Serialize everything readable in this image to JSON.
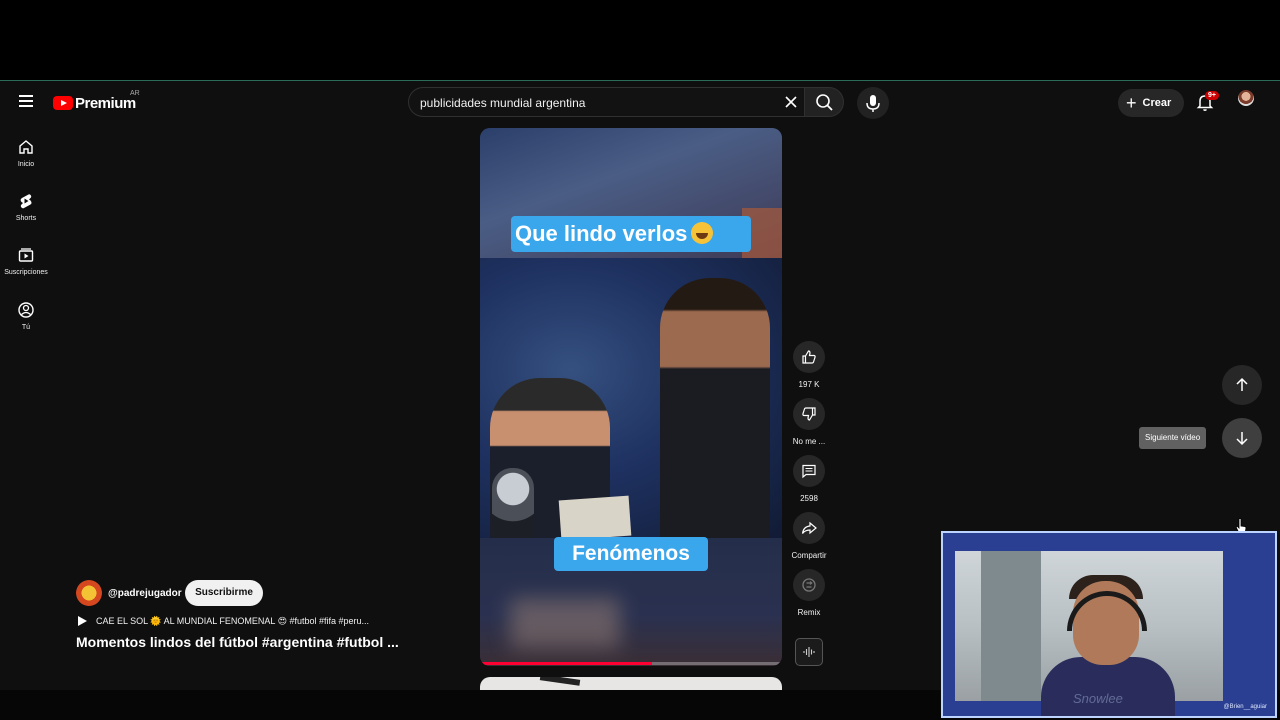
{
  "app": {
    "brand": "Premium",
    "country_code": "AR"
  },
  "search": {
    "query": "publicidades mundial argentina"
  },
  "header": {
    "create_label": "Crear",
    "notification_count": "9+"
  },
  "sidebar": {
    "items": [
      {
        "label": "Inicio",
        "icon": "home-icon"
      },
      {
        "label": "Shorts",
        "icon": "shorts-icon"
      },
      {
        "label": "Suscripciones",
        "icon": "subscriptions-icon"
      },
      {
        "label": "Tú",
        "icon": "user-icon"
      }
    ]
  },
  "short": {
    "caption_top": "Que lindo verlos",
    "caption_bottom": "Fenómenos",
    "progress": 0.57,
    "channel": "@padrejugador",
    "subscribe_label": "Suscribirme",
    "description": "CAE EL SOL 🌞 AL MUNDIAL FENOMENAL 😍 #futbol #fifa #peru...",
    "title": "Momentos lindos del fútbol #argentina #futbol ..."
  },
  "actions": {
    "like_count": "197 K",
    "dislike_label": "No me ...",
    "comment_count": "2598",
    "share_label": "Compartir",
    "remix_label": "Remix"
  },
  "navigation": {
    "next_tooltip": "Siguiente vídeo"
  },
  "webcam": {
    "handle": "@Brien__aguiar",
    "watermark": "Snowlee"
  },
  "colors": {
    "accent_red": "#ff0000",
    "caption_blue": "#3aa7ec",
    "background": "#0f0f0f"
  }
}
